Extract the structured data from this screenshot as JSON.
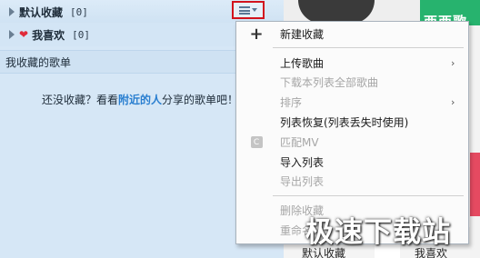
{
  "playlists": {
    "default": {
      "title": "默认收藏",
      "count": "[0]"
    },
    "liked": {
      "title": "我喜欢",
      "count": "[0]"
    },
    "my_list_label": "我收藏的歌单",
    "empty_message": {
      "prefix": "还没收藏？看看",
      "link": "附近的人",
      "suffix": "分享的歌单吧！"
    }
  },
  "context_menu": {
    "items": [
      {
        "label": "新建收藏",
        "icon": "plus-icon",
        "enabled": true
      },
      {
        "label": "上传歌曲",
        "enabled": true,
        "submenu": true
      },
      {
        "label": "下载本列表全部歌曲",
        "enabled": false
      },
      {
        "label": "排序",
        "enabled": false,
        "submenu": true
      },
      {
        "label": "列表恢复(列表丢失时使用)",
        "enabled": true
      },
      {
        "label": "匹配MV",
        "icon": "mv-icon",
        "enabled": false
      },
      {
        "label": "导入列表",
        "enabled": true
      },
      {
        "label": "导出列表",
        "enabled": false
      },
      {
        "label": "删除收藏",
        "enabled": false
      },
      {
        "label": "重命名",
        "enabled": false
      }
    ],
    "submenu_arrow": "›"
  },
  "right_panel": {
    "thumb_text": "西西歌",
    "labels": [
      "默认收藏",
      "我喜欢"
    ]
  },
  "watermark": "极速下载站",
  "colors": {
    "panel_bg": "#d6e7f6",
    "link": "#2a7fd0",
    "highlight_border": "#d2141e",
    "disabled_text": "#a6a6a6"
  }
}
